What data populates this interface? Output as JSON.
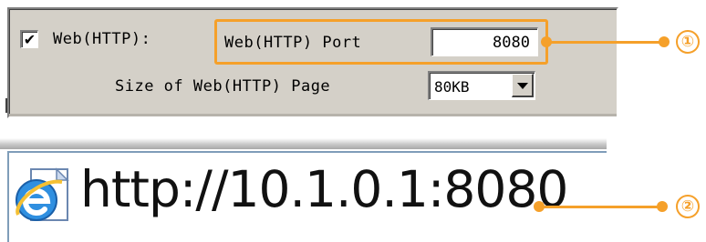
{
  "settings_panel": {
    "web_enable_checked": true,
    "checkbox_mark": "✔",
    "web_enable_label": "Web(HTTP):",
    "port_label": "Web(HTTP) Port",
    "port_value": "8080",
    "page_size_label": "Size of Web(HTTP) Page",
    "page_size_value": "80KB"
  },
  "callouts": [
    {
      "number": "①",
      "target": "port-setting"
    },
    {
      "number": "②",
      "target": "browser-url"
    }
  ],
  "browser": {
    "url": "http://10.1.0.1:8080",
    "icon": "internet-explorer-icon"
  },
  "colors": {
    "accent": "#f5a02a",
    "panel_bg": "#d4d0c8"
  }
}
